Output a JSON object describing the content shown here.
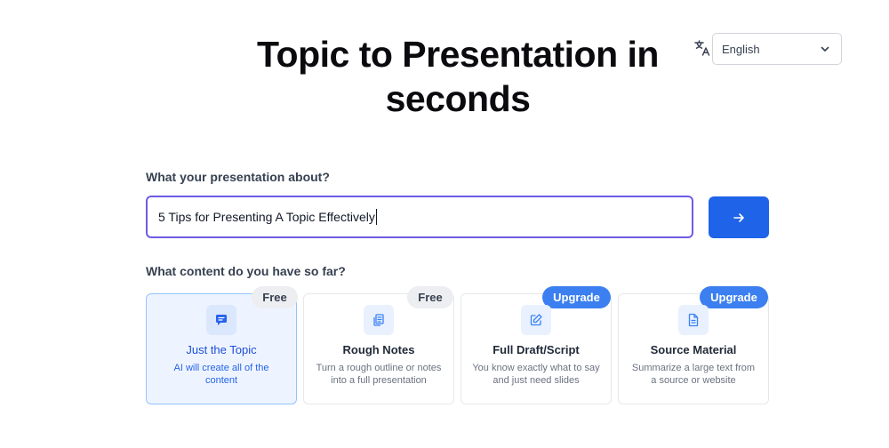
{
  "header": {
    "title": "Topic to Presentation in seconds",
    "language": {
      "icon": "translate-icon",
      "selected": "English"
    }
  },
  "prompt": {
    "label": "What your presentation about?",
    "value": "5 Tips for Presenting A Topic Effectively",
    "submit_icon": "arrow-right-icon"
  },
  "content_options": {
    "label": "What content do you have so far?",
    "cards": [
      {
        "title": "Just the Topic",
        "description": "AI will create all of the content",
        "badge": "Free",
        "icon": "chat-bubble-icon",
        "selected": true
      },
      {
        "title": "Rough Notes",
        "description": "Turn a rough outline or notes into a full presentation",
        "badge": "Free",
        "icon": "notes-icon",
        "selected": false
      },
      {
        "title": "Full Draft/Script",
        "description": "You know exactly what to say and just need slides",
        "badge": "Upgrade",
        "icon": "edit-icon",
        "selected": false
      },
      {
        "title": "Source Material",
        "description": "Summarize a large text from a source or website",
        "badge": "Upgrade",
        "icon": "document-icon",
        "selected": false
      }
    ]
  },
  "colors": {
    "accent": "#1f63e9",
    "input_focus": "#6d5ce6",
    "upgrade_badge": "#3b7ff0",
    "free_badge": "#eceef1",
    "selected_card_bg": "#eef4ff"
  }
}
